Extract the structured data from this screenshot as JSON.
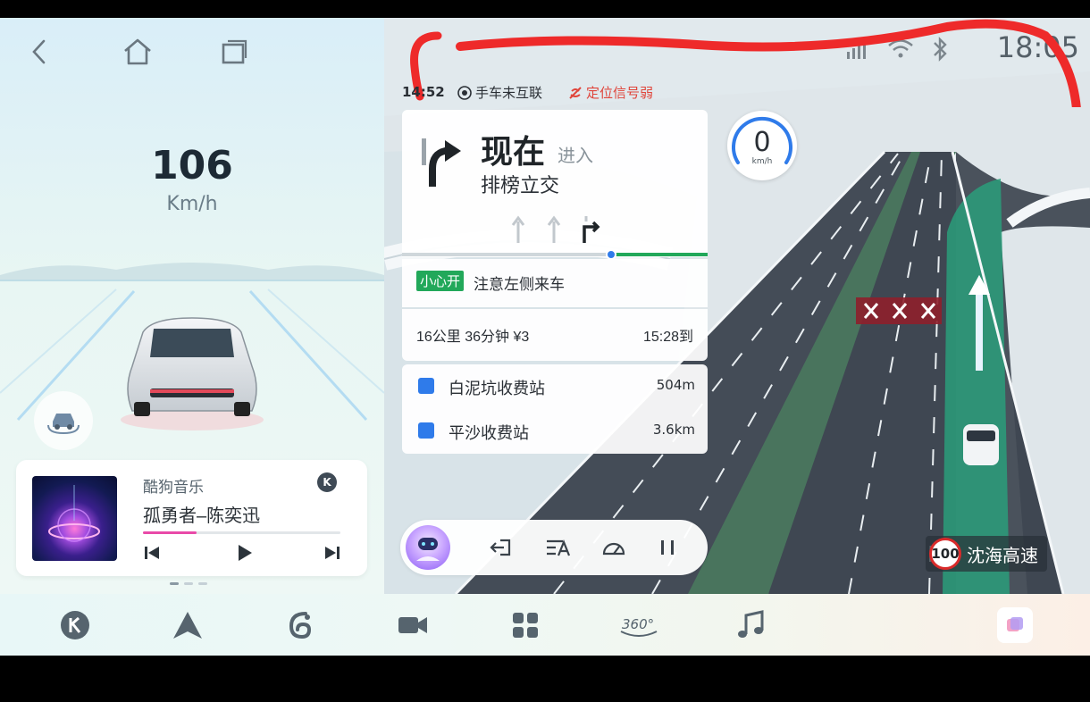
{
  "status_bar": {
    "time": "18:05",
    "icons": [
      "signal-icon",
      "wifi-icon",
      "bluetooth-icon"
    ]
  },
  "left_panel": {
    "nav": [
      "back-icon",
      "home-icon",
      "recent-apps-icon"
    ],
    "speed": "106",
    "speed_unit": "Km/h"
  },
  "music": {
    "app_name": "酷狗音乐",
    "song": "孤勇者–陈奕迅",
    "badge": "K",
    "progress": 0.27,
    "controls": [
      "previous-icon",
      "play-icon",
      "next-icon"
    ],
    "page_dots": 3,
    "active_dot": 0
  },
  "navigation": {
    "time": "14:52",
    "phone_link": "手车未互联",
    "gps_status": "定位信号弱",
    "guide": {
      "now": "现在",
      "enter": "进入",
      "road": "排榜立交"
    },
    "warning": {
      "tag": "小心开",
      "text": "注意左侧来车"
    },
    "eta": {
      "summary": "16公里 36分钟 ¥3",
      "arrival": "15:28到"
    },
    "tolls": [
      {
        "name": "白泥坑收费站",
        "distance": "504m"
      },
      {
        "name": "平沙收费站",
        "distance": "3.6km"
      }
    ],
    "current_speed": "0",
    "current_speed_unit": "km/h",
    "speed_limit": "100",
    "road_name": "沈海高速"
  },
  "colors": {
    "accent_green": "#22a85a",
    "warning_red": "#e0453b",
    "route_green": "#2a9d7a",
    "progress_pink": "#e94aa8"
  },
  "dock": [
    "kugou-icon",
    "navigation-icon",
    "voice-assistant-icon",
    "dashcam-icon",
    "apps-icon",
    "360-camera-icon",
    "music-icon",
    "multitask-icon"
  ],
  "dock_360_label": "360°"
}
